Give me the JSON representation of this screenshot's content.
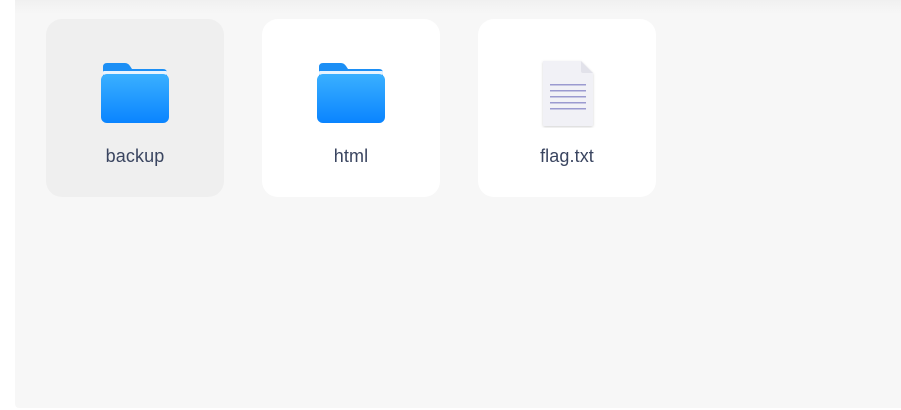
{
  "files": [
    {
      "name": "backup",
      "kind": "folder",
      "selected": true
    },
    {
      "name": "html",
      "kind": "folder",
      "selected": false
    },
    {
      "name": "flag.txt",
      "kind": "text-file",
      "selected": false
    }
  ],
  "colors": {
    "panel_bg": "#f7f7f7",
    "tile_bg": "#ffffff",
    "tile_selected_bg": "#efefef",
    "folder_blue_top": "#3ab0ff",
    "folder_blue_bottom": "#0a84ff",
    "label_text": "#3a4560"
  },
  "icons": {
    "folder": "folder-icon",
    "text_file": "text-file-icon"
  }
}
